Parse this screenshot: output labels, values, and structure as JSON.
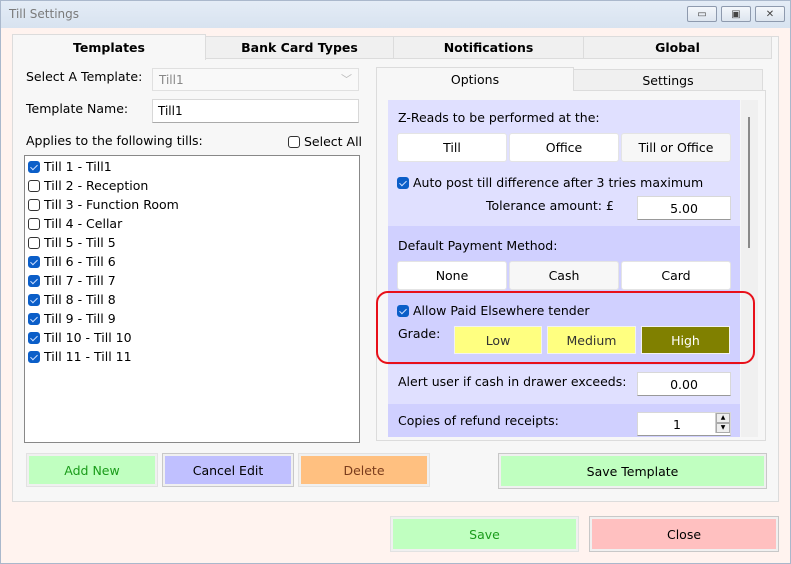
{
  "window": {
    "title": "Till Settings",
    "controls": [
      "minimize",
      "maximize",
      "close"
    ]
  },
  "outer_tabs": [
    {
      "label": "Templates",
      "active": true
    },
    {
      "label": "Bank Card Types",
      "active": false
    },
    {
      "label": "Notifications",
      "active": false
    },
    {
      "label": "Global",
      "active": false
    }
  ],
  "templates": {
    "select_label": "Select A Template:",
    "select_value": "Till1",
    "name_label": "Template Name:",
    "name_value": "Till1",
    "applies_label": "Applies to the following tills:",
    "select_all_label": "Select All",
    "select_all_checked": false,
    "tills": [
      {
        "label": "Till 1 - Till1",
        "checked": true
      },
      {
        "label": "Till 2 - Reception",
        "checked": false
      },
      {
        "label": "Till 3 - Function Room",
        "checked": false
      },
      {
        "label": "Till 4 - Cellar",
        "checked": false
      },
      {
        "label": "Till 5 - Till 5",
        "checked": false
      },
      {
        "label": "Till 6 - Till 6",
        "checked": true
      },
      {
        "label": "Till 7 - Till 7",
        "checked": true
      },
      {
        "label": "Till 8 - Till 8",
        "checked": true
      },
      {
        "label": "Till 9 - Till 9",
        "checked": true
      },
      {
        "label": "Till 10 - Till 10",
        "checked": true
      },
      {
        "label": "Till 11 - Till 11",
        "checked": true
      }
    ],
    "buttons": {
      "add_new": "Add New",
      "cancel_edit": "Cancel Edit",
      "delete": "Delete",
      "save_template": "Save Template"
    }
  },
  "inner_tabs": [
    {
      "label": "Options",
      "active": true
    },
    {
      "label": "Settings",
      "active": false
    }
  ],
  "options": {
    "zreads_label": "Z-Reads to be performed at the:",
    "zreads_options": [
      "Till",
      "Office",
      "Till or Office"
    ],
    "auto_post_label": "Auto post till difference after 3 tries maximum",
    "auto_post_checked": true,
    "tolerance_label": "Tolerance amount: £",
    "tolerance_value": "5.00",
    "payment_label": "Default Payment Method:",
    "payment_options": [
      "None",
      "Cash",
      "Card"
    ],
    "paid_elsewhere_label": "Allow Paid Elsewhere tender",
    "paid_elsewhere_checked": true,
    "grade_label": "Grade:",
    "grade_options": [
      "Low",
      "Medium",
      "High"
    ],
    "grade_selected": "High",
    "alert_label": "Alert user if cash in drawer exceeds:",
    "alert_value": "0.00",
    "refund_label": "Copies of refund receipts:",
    "refund_value": "1"
  },
  "footer": {
    "save": "Save",
    "close": "Close"
  },
  "colors": {
    "green_button": "#c0ffc0",
    "purple_button": "#c0c0ff",
    "orange_button": "#ffc080",
    "red_button": "#ffc0c0",
    "grade_yellow": "#ffff80",
    "grade_selected": "#808000",
    "highlight_red": "#e8101a",
    "section_light": "#e0e0ff",
    "section_dark": "#d0d0ff"
  }
}
